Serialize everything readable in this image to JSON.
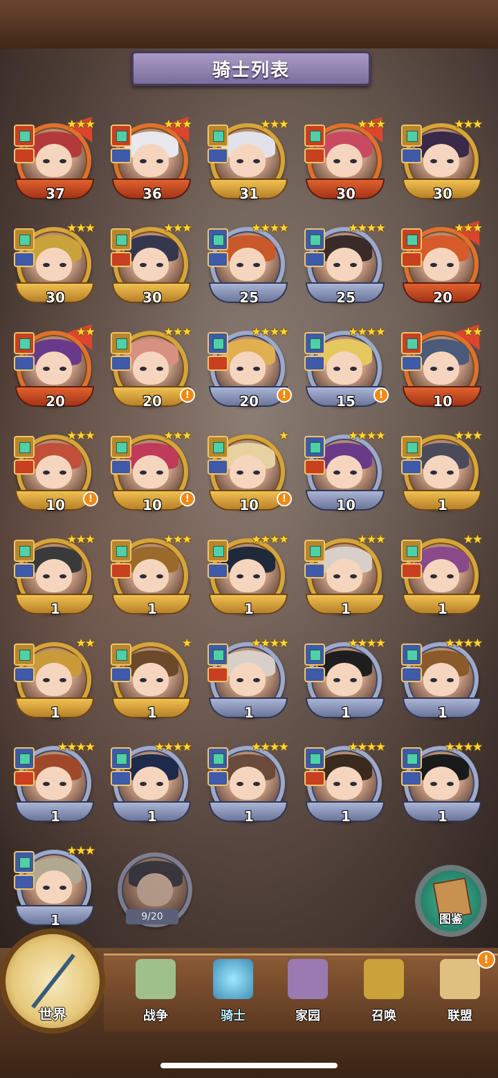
{
  "title": "骑士列表",
  "knights": [
    {
      "level": "37",
      "stars": "★★★",
      "frame": "red",
      "upgrade": true,
      "alert": false,
      "hair": "#b33a3a"
    },
    {
      "level": "36",
      "stars": "★★★",
      "frame": "red",
      "upgrade": true,
      "alert": false,
      "hair": "#e8e8ee"
    },
    {
      "level": "31",
      "stars": "★★★",
      "frame": "gold",
      "upgrade": false,
      "alert": false,
      "hair": "#e2e2ea"
    },
    {
      "level": "30",
      "stars": "★★★",
      "frame": "red",
      "upgrade": true,
      "alert": false,
      "hair": "#c94a60"
    },
    {
      "level": "30",
      "stars": "★★★",
      "frame": "gold",
      "upgrade": false,
      "alert": false,
      "hair": "#3a2a4a"
    },
    {
      "level": "30",
      "stars": "★★★",
      "frame": "gold",
      "upgrade": false,
      "alert": false,
      "hair": "#c9a23a"
    },
    {
      "level": "30",
      "stars": "★★★",
      "frame": "gold",
      "upgrade": false,
      "alert": false,
      "hair": "#34384f"
    },
    {
      "level": "25",
      "stars": "★★★★",
      "frame": "blue",
      "upgrade": false,
      "alert": false,
      "hair": "#c9582a"
    },
    {
      "level": "25",
      "stars": "★★★★",
      "frame": "blue",
      "upgrade": false,
      "alert": false,
      "hair": "#3a2a2a"
    },
    {
      "level": "20",
      "stars": "★★★",
      "frame": "red",
      "upgrade": true,
      "alert": false,
      "hair": "#d65a2a"
    },
    {
      "level": "20",
      "stars": "★★",
      "frame": "red",
      "upgrade": true,
      "alert": false,
      "hair": "#6a3a8a"
    },
    {
      "level": "20",
      "stars": "★★★",
      "frame": "gold",
      "upgrade": false,
      "alert": true,
      "hair": "#d89080"
    },
    {
      "level": "20",
      "stars": "★★★★",
      "frame": "blue",
      "upgrade": false,
      "alert": true,
      "hair": "#e0b050"
    },
    {
      "level": "15",
      "stars": "★★★★",
      "frame": "blue",
      "upgrade": false,
      "alert": true,
      "hair": "#e6c860"
    },
    {
      "level": "10",
      "stars": "★★",
      "frame": "red",
      "upgrade": true,
      "alert": false,
      "hair": "#4a5a7a"
    },
    {
      "level": "10",
      "stars": "★★★",
      "frame": "gold",
      "upgrade": false,
      "alert": true,
      "hair": "#c0503a"
    },
    {
      "level": "10",
      "stars": "★★★",
      "frame": "gold",
      "upgrade": false,
      "alert": true,
      "hair": "#c03a5a"
    },
    {
      "level": "10",
      "stars": "★",
      "frame": "gold",
      "upgrade": false,
      "alert": true,
      "hair": "#e6d2a0"
    },
    {
      "level": "10",
      "stars": "★★★★",
      "frame": "blue",
      "upgrade": false,
      "alert": false,
      "hair": "#6a3a8a"
    },
    {
      "level": "1",
      "stars": "★★★",
      "frame": "gold",
      "upgrade": false,
      "alert": false,
      "hair": "#4a4a5a"
    },
    {
      "level": "1",
      "stars": "★★★",
      "frame": "gold",
      "upgrade": false,
      "alert": false,
      "hair": "#3a3a3a"
    },
    {
      "level": "1",
      "stars": "★★★",
      "frame": "gold",
      "upgrade": false,
      "alert": false,
      "hair": "#9a6a2a"
    },
    {
      "level": "1",
      "stars": "★★★★",
      "frame": "gold",
      "upgrade": false,
      "alert": false,
      "hair": "#1e2a3a"
    },
    {
      "level": "1",
      "stars": "★★★",
      "frame": "gold",
      "upgrade": false,
      "alert": false,
      "hair": "#d8d0c8"
    },
    {
      "level": "1",
      "stars": "★★",
      "frame": "gold",
      "upgrade": false,
      "alert": false,
      "hair": "#8a4a8a"
    },
    {
      "level": "1",
      "stars": "★★",
      "frame": "gold",
      "upgrade": false,
      "alert": false,
      "hair": "#c99a3a"
    },
    {
      "level": "1",
      "stars": "★",
      "frame": "gold",
      "upgrade": false,
      "alert": false,
      "hair": "#6a4a2a"
    },
    {
      "level": "1",
      "stars": "★★★★",
      "frame": "blue",
      "upgrade": false,
      "alert": false,
      "hair": "#d8d0c8"
    },
    {
      "level": "1",
      "stars": "★★★★",
      "frame": "blue",
      "upgrade": false,
      "alert": false,
      "hair": "#1e1e1e"
    },
    {
      "level": "1",
      "stars": "★★★★",
      "frame": "blue",
      "upgrade": false,
      "alert": false,
      "hair": "#8a5a2a"
    },
    {
      "level": "1",
      "stars": "★★★★",
      "frame": "blue",
      "upgrade": false,
      "alert": false,
      "hair": "#a0482a"
    },
    {
      "level": "1",
      "stars": "★★★★",
      "frame": "blue",
      "upgrade": false,
      "alert": false,
      "hair": "#1e2a4a"
    },
    {
      "level": "1",
      "stars": "★★★★",
      "frame": "blue",
      "upgrade": false,
      "alert": false,
      "hair": "#6a4a3a"
    },
    {
      "level": "1",
      "stars": "★★★★",
      "frame": "blue",
      "upgrade": false,
      "alert": false,
      "hair": "#3a2a1e"
    },
    {
      "level": "1",
      "stars": "★★★★",
      "frame": "blue",
      "upgrade": false,
      "alert": false,
      "hair": "#1a1a1a"
    },
    {
      "level": "1",
      "stars": "★★★",
      "frame": "blue",
      "upgrade": false,
      "alert": false,
      "hair": "#b0a890"
    }
  ],
  "locked_knight": {
    "progress": "9/20"
  },
  "gallery_label": "图鉴",
  "nav": {
    "world": "世界",
    "items": [
      {
        "label": "战争",
        "color": "#9fc08a"
      },
      {
        "label": "骑士",
        "color": "#6fb8d8",
        "active": true
      },
      {
        "label": "家园",
        "color": "#9a7ab0"
      },
      {
        "label": "召唤",
        "color": "#c9a23a"
      },
      {
        "label": "联盟",
        "color": "#e0c080"
      }
    ],
    "alert": "!"
  }
}
